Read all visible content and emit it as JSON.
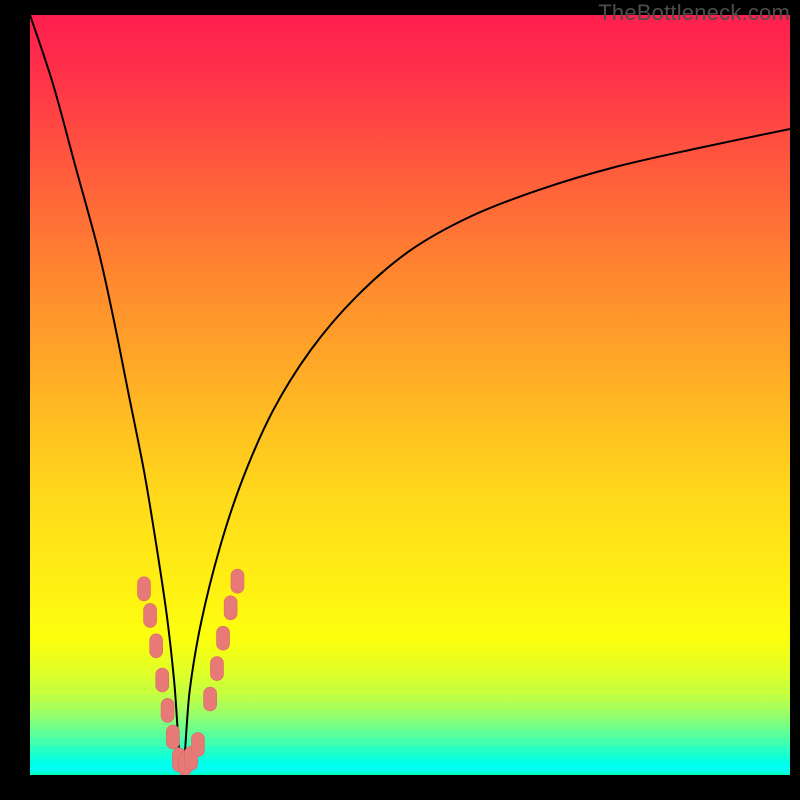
{
  "watermark": "TheBottleneck.com",
  "colors": {
    "frame": "#000000",
    "curve_stroke": "#000000",
    "marker_fill": "#e77a77",
    "marker_stroke": "#d96a67"
  },
  "chart_data": {
    "type": "line",
    "title": "",
    "xlabel": "",
    "ylabel": "",
    "xlim": [
      0,
      100
    ],
    "ylim": [
      0,
      100
    ],
    "grid": false,
    "legend": null,
    "description": "Bottleneck-style V curve: the y value represents mismatch/bottleneck percentage (higher = worse, red; 0 = optimal, green). The curve drops steeply from 100 on the left, reaches a sharp minimum of 0 near x≈20, then rises asymptotically toward ~80–85 on the right.",
    "optimal_x": 20,
    "series": [
      {
        "name": "bottleneck-curve",
        "x": [
          0,
          3,
          6,
          9,
          11,
          13,
          15,
          16.5,
          18,
          19,
          20,
          21,
          22.5,
          25,
          28,
          32,
          37,
          43,
          50,
          58,
          67,
          77,
          88,
          100
        ],
        "values": [
          100,
          91,
          80,
          69,
          60,
          50,
          40,
          31,
          21,
          12,
          0,
          11,
          20,
          30,
          39,
          48,
          56,
          63,
          69,
          73.5,
          77,
          80,
          82.5,
          85
        ]
      }
    ],
    "markers": {
      "description": "Salmon-colored data point markers clustered around the minimum of the curve (the low-bottleneck region).",
      "points": [
        {
          "x": 15.0,
          "y": 24.5
        },
        {
          "x": 15.8,
          "y": 21.0
        },
        {
          "x": 16.6,
          "y": 17.0
        },
        {
          "x": 17.4,
          "y": 12.5
        },
        {
          "x": 18.1,
          "y": 8.5
        },
        {
          "x": 18.8,
          "y": 5.0
        },
        {
          "x": 19.6,
          "y": 2.0
        },
        {
          "x": 20.4,
          "y": 1.5
        },
        {
          "x": 21.2,
          "y": 2.2
        },
        {
          "x": 22.1,
          "y": 4.0
        },
        {
          "x": 23.7,
          "y": 10.0
        },
        {
          "x": 24.6,
          "y": 14.0
        },
        {
          "x": 25.4,
          "y": 18.0
        },
        {
          "x": 26.4,
          "y": 22.0
        },
        {
          "x": 27.3,
          "y": 25.5
        }
      ]
    }
  }
}
